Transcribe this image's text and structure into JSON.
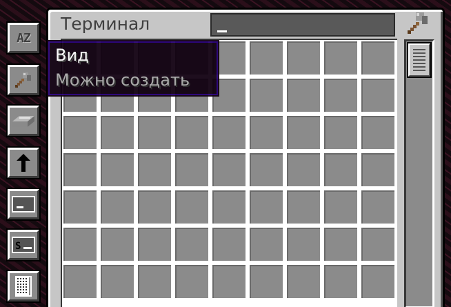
{
  "terminal": {
    "title": "Терминал",
    "search_value": ""
  },
  "tooltip": {
    "title": "Вид",
    "line": "Можно создать"
  },
  "sidebar": {
    "items": [
      {
        "name": "sort-az-button",
        "label": "AZ"
      },
      {
        "name": "view-craftable-button",
        "icon": "hammer-icon"
      },
      {
        "name": "terminal-style-button",
        "icon": "ingot-icon"
      },
      {
        "name": "sort-direction-button",
        "icon": "arrow-up-icon"
      },
      {
        "name": "search-mode-button",
        "icon": "search-box-icon"
      },
      {
        "name": "search-mode-sync-button",
        "icon": "search-s-icon"
      },
      {
        "name": "terminal-size-button",
        "icon": "size-icon"
      }
    ]
  },
  "grid": {
    "columns": 9,
    "rows": 7
  },
  "colors": {
    "panel": "#c6c6c6",
    "slot": "#8b8b8b",
    "tooltip_bg": "#100010",
    "tooltip_border": "#28007a"
  }
}
